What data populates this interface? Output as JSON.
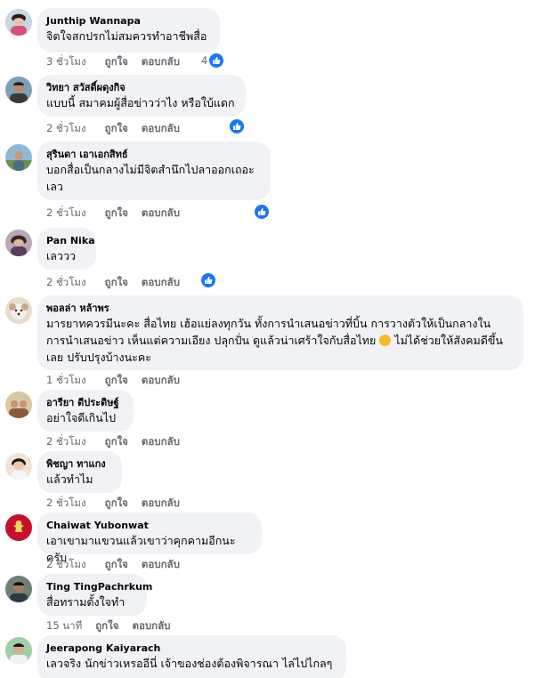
{
  "labels": {
    "like": "ถูกใจ",
    "reply": "ตอบกลับ"
  },
  "colors": {
    "bubble_bg": "#f0f2f5",
    "like_blue": "#1877f2",
    "meta_gray": "#65676b"
  },
  "comments": [
    {
      "author": "Junthip Wannapa",
      "text": "จิตใจสกปรกไม่สมควรทำอาชีพสื่อ",
      "time": "3 ชั่วโมง",
      "reactions": "4",
      "avatar_icon": "woman-avatar-icon"
    },
    {
      "author": "วิทยา สวัสดิ์ผดุงกิจ",
      "text": "แบบนี้ สมาคมผู้สื่อข่าวว่าไง หรือใบ้แดก",
      "time": "2 ชั่วโมง",
      "reactions": "",
      "avatar_icon": "man-avatar-icon"
    },
    {
      "author": "สุรินดา เอาเอกสิทธ์",
      "text": "บอกสื่อเป็นกลางไม่มีจิตสำนึกไปลาออกเถอะ\nเลว",
      "time": "2 ชั่วโมง",
      "reactions": "",
      "avatar_icon": "landscape-avatar-icon"
    },
    {
      "author": "Pan Nika",
      "text": "เลววว",
      "time": "2 ชั่วโมง",
      "reactions": "",
      "avatar_icon": "woman-avatar-icon"
    },
    {
      "author": "พอลล่า หล้าพร",
      "text_lines": [
        "มารยาทควรมีนะคะ สื่อไทย เฮ้อแย่ลงทุกวัน ทั้งการนำเสนอข่าวที่บิ้น การวางตัวให้เป็นกลางใน",
        "การนำเสนอข่าว เห็นแต่ความเอียง ปลุกปั่น ดูแล้วน่าเศร้าใจกับสื่อไทย",
        " ไม่ได้ช่วยให้สังคมดีขึ้น",
        "เลย ปรับปรุงบ้างนะคะ"
      ],
      "emoji": "sad-face-emoji",
      "time": "1 ชั่วโมง",
      "reactions": "",
      "avatar_icon": "dog-avatar-icon"
    },
    {
      "author": "อารียา ดีประดิษฐ์",
      "text": "อย่าใจดีเกินไป",
      "time": "2 ชั่วโมง",
      "reactions": "",
      "avatar_icon": "group-avatar-icon"
    },
    {
      "author": "พิชญา ทาแกง",
      "text": "แล้วทำไม",
      "time": "2 ชั่วโมง",
      "reactions": "",
      "avatar_icon": "woman-avatar-icon"
    },
    {
      "author": "Chaiwat Yubonwat",
      "text": "เอาเขามาแขวนแล้วเขาว่าคุกคามอีกนะครับ",
      "time": "2 ชั่วโมง",
      "reactions": "",
      "avatar_icon": "liverpool-crest-avatar-icon"
    },
    {
      "author": "Ting TingPachrkum",
      "text": "สื่อทรามตั้งใจทำ",
      "time": "15 นาที",
      "reactions": "",
      "avatar_icon": "man-avatar-icon"
    },
    {
      "author": "Jeerapong Kaiyarach",
      "text": "เลวจริง นักข่าวเหรออีนี่ เจ้าของช่องต้องพิจารณา ไล่ไปไกลๆ",
      "time": "",
      "reactions": "",
      "avatar_icon": "man-avatar-icon"
    }
  ]
}
